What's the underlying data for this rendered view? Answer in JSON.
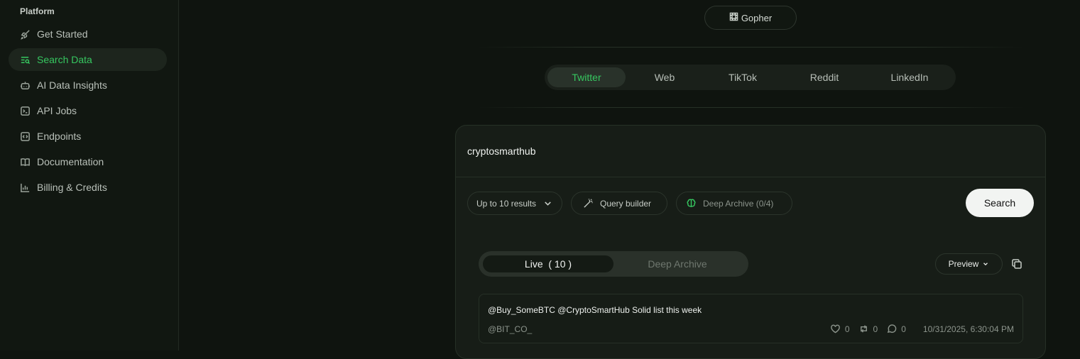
{
  "sidebar": {
    "section_title": "Platform",
    "items": [
      {
        "label": "Get Started",
        "icon": "rocket-icon"
      },
      {
        "label": "Search Data",
        "icon": "search-list-icon",
        "active": true
      },
      {
        "label": "AI Data Insights",
        "icon": "bot-icon"
      },
      {
        "label": "API Jobs",
        "icon": "terminal-icon"
      },
      {
        "label": "Endpoints",
        "icon": "code-icon"
      },
      {
        "label": "Documentation",
        "icon": "book-icon"
      },
      {
        "label": "Billing & Credits",
        "icon": "bar-chart-icon"
      }
    ]
  },
  "header": {
    "badge": "Gopher"
  },
  "source_tabs": [
    {
      "label": "Twitter",
      "active": true
    },
    {
      "label": "Web"
    },
    {
      "label": "TikTok"
    },
    {
      "label": "Reddit"
    },
    {
      "label": "LinkedIn"
    }
  ],
  "query": {
    "value": "cryptosmarthub"
  },
  "options": {
    "results_limit": "Up to 10 results",
    "query_builder": "Query builder",
    "deep_archive": "Deep Archive (0/4)"
  },
  "search_button": "Search",
  "result_tabs": {
    "live": "Live  ( 10 )",
    "archive": "Deep Archive"
  },
  "preview_button": "Preview",
  "results": [
    {
      "text": "@Buy_SomeBTC @CryptoSmartHub Solid list this week",
      "handle": "@BIT_CO_",
      "likes": "0",
      "retweets": "0",
      "replies": "0",
      "timestamp": "10/31/2025, 6:30:04 PM"
    }
  ],
  "colors": {
    "accent": "#36c760",
    "background": "#0f140f",
    "card": "#171d17"
  }
}
